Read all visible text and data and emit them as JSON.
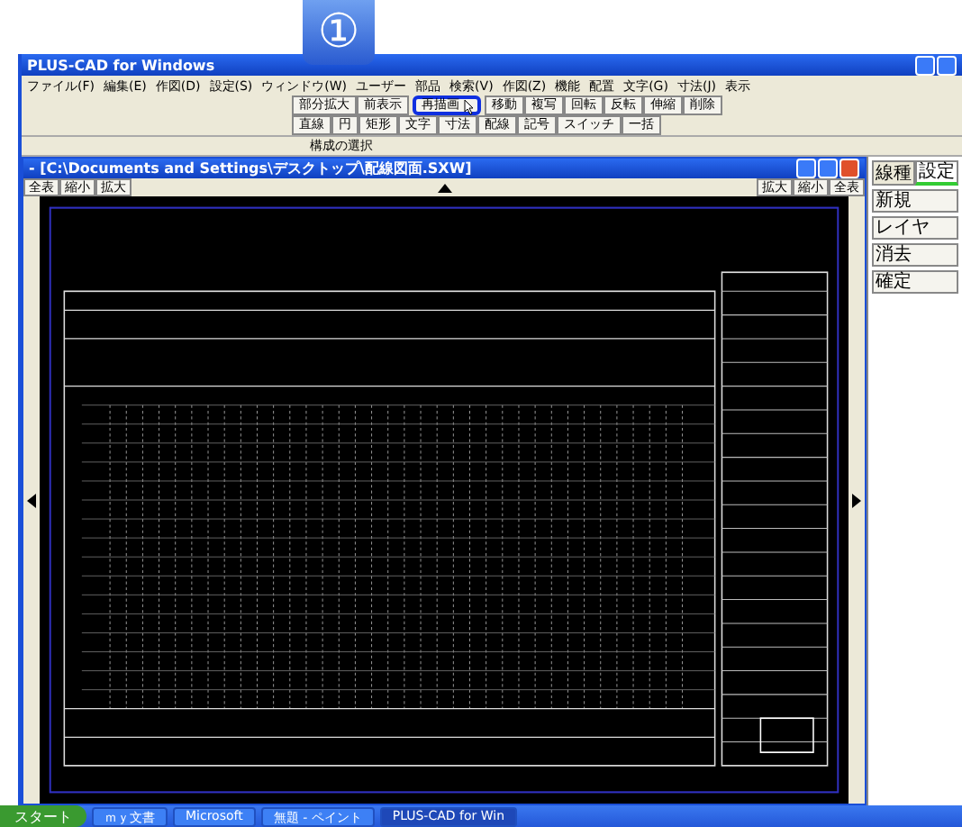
{
  "callout": {
    "label": "①"
  },
  "app": {
    "title": "PLUS-CAD for Windows",
    "menu": [
      "ファイル(F)",
      "編集(E)",
      "作図(D)",
      "設定(S)",
      "ウィンドウ(W)",
      "ユーザー",
      "部品",
      "検索(V)",
      "作図(Z)",
      "機能",
      "配置",
      "文字(G)",
      "寸法(J)",
      "表示"
    ],
    "toolbar_rows": [
      [
        {
          "label": "部分拡大",
          "highlighted": false
        },
        {
          "label": "前表示",
          "highlighted": false
        },
        {
          "label": "再描画",
          "highlighted": true
        },
        {
          "label": "移動",
          "highlighted": false
        },
        {
          "label": "複写",
          "highlighted": false
        },
        {
          "label": "回転",
          "highlighted": false
        },
        {
          "label": "反転",
          "highlighted": false
        },
        {
          "label": "伸縮",
          "highlighted": false
        },
        {
          "label": "削除",
          "highlighted": false
        }
      ],
      [
        {
          "label": "直線",
          "highlighted": false
        },
        {
          "label": "円",
          "highlighted": false
        },
        {
          "label": "矩形",
          "highlighted": false
        },
        {
          "label": "文字",
          "highlighted": false
        },
        {
          "label": "寸法",
          "highlighted": false
        },
        {
          "label": "配線",
          "highlighted": false
        },
        {
          "label": "記号",
          "highlighted": false
        },
        {
          "label": "スイッチ",
          "highlighted": false
        },
        {
          "label": "一括",
          "highlighted": false
        }
      ]
    ],
    "status": "構成の選択"
  },
  "document": {
    "title": "- [C:\\Documents and Settings\\デスクトップ\\配線図面.SXW]",
    "zoom_left": [
      "全表",
      "縮小",
      "拡大"
    ],
    "zoom_right": [
      "拡大",
      "縮小",
      "全表"
    ]
  },
  "side_panel": {
    "tabs": [
      {
        "label": "線種",
        "selected": false
      },
      {
        "label": "設定",
        "selected": true
      }
    ],
    "rows": [
      "新規",
      "レイヤ",
      "消去",
      "確定"
    ]
  },
  "taskbar": {
    "start": "スタート",
    "tasks": [
      {
        "label": "ｍｙ文書",
        "selected": false
      },
      {
        "label": "Microsoft",
        "selected": false
      },
      {
        "label": "無題 - ペイント",
        "selected": false
      },
      {
        "label": "PLUS-CAD for Win",
        "selected": true
      }
    ]
  }
}
